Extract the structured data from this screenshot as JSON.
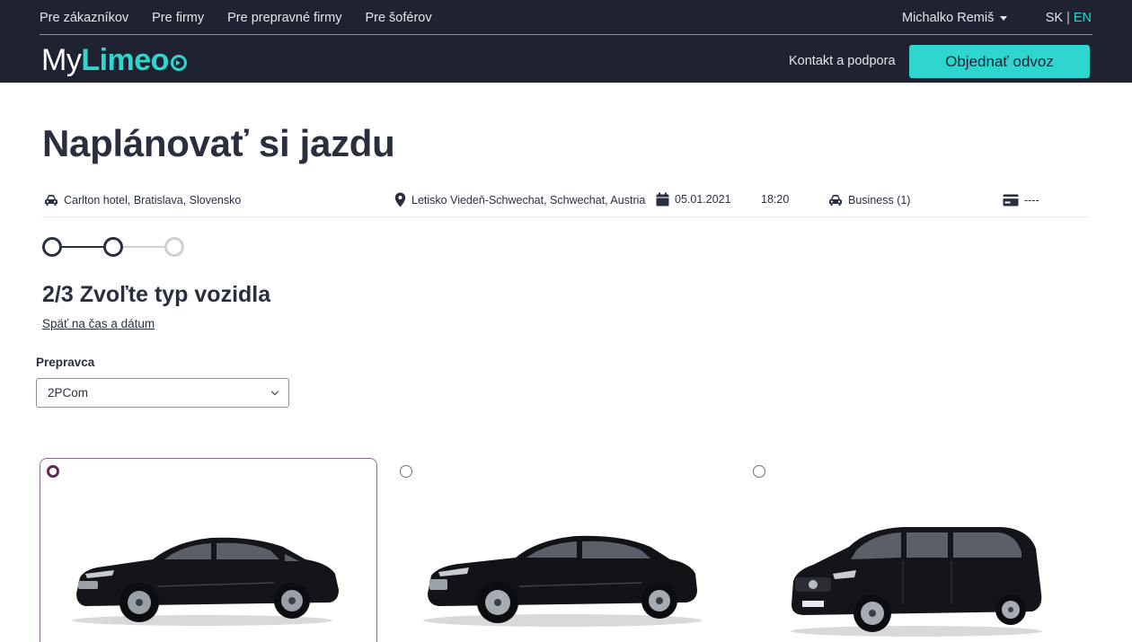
{
  "nav": {
    "links": [
      "Pre zákazníkov",
      "Pre firmy",
      "Pre prepravné firmy",
      "Pre šoférov"
    ],
    "user_name": "Michalko Remiš",
    "lang_sk": "SK",
    "lang_sep": "|",
    "lang_en": "EN"
  },
  "brand": {
    "my": "My",
    "limeo": "Limeo"
  },
  "header": {
    "support_label": "Kontakt a podpora",
    "order_label": "Objednať odvoz"
  },
  "page": {
    "title": "Naplánovať si jazdu"
  },
  "summary": {
    "pickup": "Carlton hotel, Bratislava, Slovensko",
    "destination": "Letisko Viedeň-Schwechat, Schwechat, Austria",
    "date": "05.01.2021",
    "time": "18:20",
    "vehicle_class": "Business (1)",
    "payment": "----"
  },
  "stepper": {
    "current_step": 2,
    "total_steps": 3
  },
  "step": {
    "heading": "2/3 Zvoľte typ vozidla",
    "back_link": "Späť na čas a dátum"
  },
  "carrier": {
    "label": "Prepravca",
    "selected": "2PCom"
  },
  "vehicles": [
    {
      "type": "sedan",
      "selected": true
    },
    {
      "type": "limousine",
      "selected": false
    },
    {
      "type": "van",
      "selected": false
    }
  ],
  "colors": {
    "header_bg": "#1f2331",
    "accent": "#2fd6cf",
    "selected_border": "#8b6a8f",
    "radio_checked": "#5b2a55",
    "step_active": "#2a2f3f",
    "step_inactive": "#cfd0d4"
  },
  "icons": {
    "pickup": "car-icon",
    "destination": "map-pin-icon",
    "date": "calendar-icon",
    "vehicle_class": "car-icon",
    "payment": "credit-card-icon",
    "user_menu": "caret-down-icon",
    "select": "chevron-down-icon"
  }
}
